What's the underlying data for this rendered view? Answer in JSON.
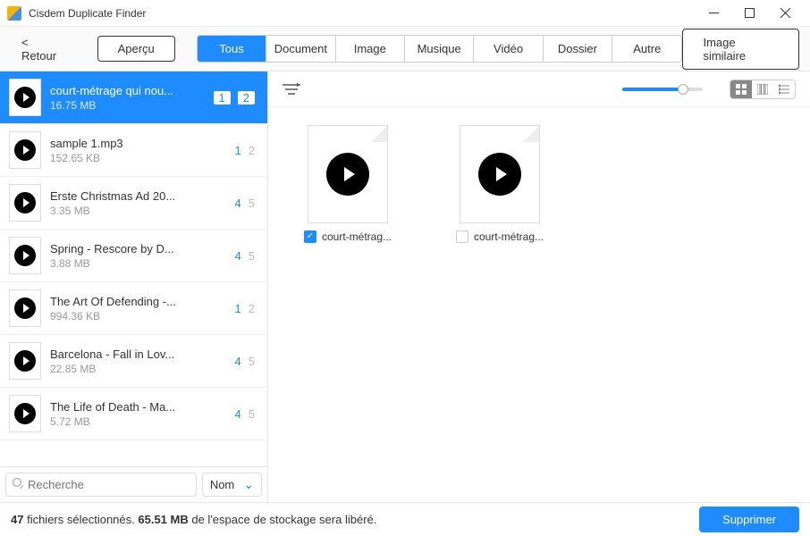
{
  "titlebar": {
    "title": "Cisdem Duplicate Finder"
  },
  "toolbar": {
    "back": "< Retour",
    "preview": "Aperçu",
    "tabs": [
      "Tous",
      "Document",
      "Image",
      "Musique",
      "Vidéo",
      "Dossier",
      "Autre"
    ],
    "active_tab": 0,
    "similar": "Image similaire"
  },
  "list": {
    "items": [
      {
        "name": "court-métrage qui nou...",
        "size": "16.75 MB",
        "sel": "1",
        "tot": "2",
        "selected": true
      },
      {
        "name": "sample 1.mp3",
        "size": "152.65 KB",
        "sel": "1",
        "tot": "2"
      },
      {
        "name": "Erste Christmas Ad 20...",
        "size": "3.35 MB",
        "sel": "4",
        "tot": "5"
      },
      {
        "name": "Spring - Rescore by D...",
        "size": "3.88 MB",
        "sel": "4",
        "tot": "5"
      },
      {
        "name": "The Art Of Defending -...",
        "size": "994.36 KB",
        "sel": "1",
        "tot": "2"
      },
      {
        "name": "Barcelona - Fall in Lov...",
        "size": "22.85 MB",
        "sel": "4",
        "tot": "5"
      },
      {
        "name": "The Life of Death - Ma...",
        "size": "5.72 MB",
        "sel": "4",
        "tot": "5"
      }
    ]
  },
  "search": {
    "placeholder": "Recherche",
    "sort_label": "Nom"
  },
  "grid": {
    "items": [
      {
        "name": "court-métrag...",
        "checked": true
      },
      {
        "name": "court-métrag...",
        "checked": false
      }
    ]
  },
  "footer": {
    "count": "47",
    "text1": " fichiers sélectionnés. ",
    "size": "65.51 MB",
    "text2": " de l'espace de stockage sera libéré.",
    "delete": "Supprimer"
  }
}
